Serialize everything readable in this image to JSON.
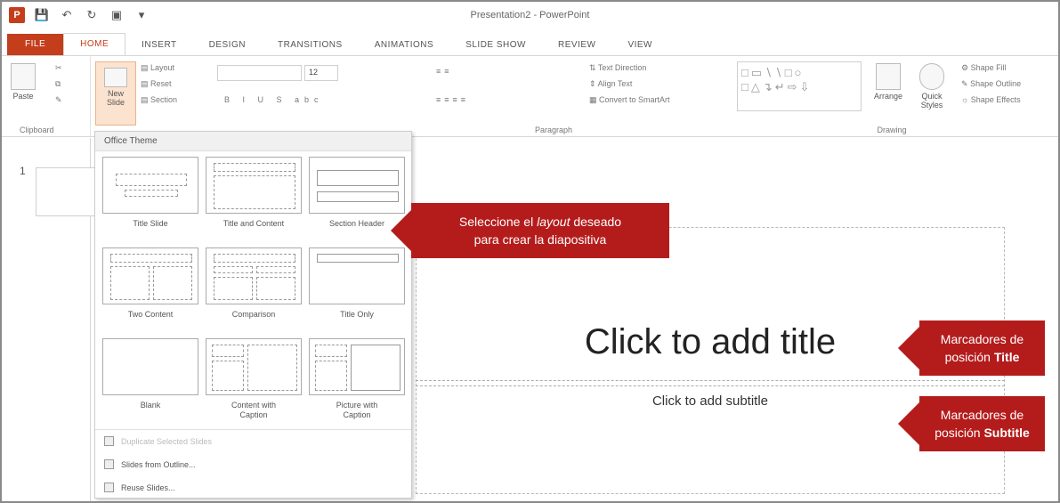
{
  "window": {
    "title": "Presentation2 - PowerPoint"
  },
  "tabs": [
    {
      "label": "FILE"
    },
    {
      "label": "HOME"
    },
    {
      "label": "INSERT"
    },
    {
      "label": "DESIGN"
    },
    {
      "label": "TRANSITIONS"
    },
    {
      "label": "ANIMATIONS"
    },
    {
      "label": "SLIDE SHOW"
    },
    {
      "label": "REVIEW"
    },
    {
      "label": "VIEW"
    }
  ],
  "ribbon": {
    "clipboard": {
      "paste": "Paste",
      "label": "Clipboard"
    },
    "slides": {
      "new_slide": "New Slide",
      "layout": "Layout",
      "reset": "Reset",
      "section": "Section"
    },
    "font": {
      "size": "12"
    },
    "paragraph": {
      "label": "Paragraph",
      "text_direction": "Text Direction",
      "align_text": "Align Text",
      "smartart": "Convert to SmartArt"
    },
    "drawing": {
      "label": "Drawing",
      "arrange": "Arrange",
      "quick_styles": "Quick Styles",
      "shape_fill": "Shape Fill",
      "shape_outline": "Shape Outline",
      "shape_effects": "Shape Effects"
    }
  },
  "thumbnail": {
    "number": "1"
  },
  "gallery": {
    "header": "Office Theme",
    "layouts": [
      {
        "name": "Title Slide"
      },
      {
        "name": "Title and Content"
      },
      {
        "name": "Section Header"
      },
      {
        "name": "Two Content"
      },
      {
        "name": "Comparison"
      },
      {
        "name": "Title Only"
      },
      {
        "name": "Blank"
      },
      {
        "name": "Content with\nCaption"
      },
      {
        "name": "Picture with\nCaption"
      }
    ],
    "menu": {
      "duplicate": "Duplicate Selected Slides",
      "outline": "Slides from Outline...",
      "reuse": "Reuse Slides..."
    }
  },
  "slide": {
    "title_placeholder": "Click to add title",
    "subtitle_placeholder": "Click to add subtitle"
  },
  "callouts": {
    "layout_pre": "Seleccione el ",
    "layout_em": "layout",
    "layout_post": " deseado",
    "layout_line2": "para crear la diapositiva",
    "title_line1": "Marcadores de",
    "title_pre": "posición ",
    "title_em": "Title",
    "subtitle_line1": "Marcadores de",
    "subtitle_pre": "posición ",
    "subtitle_em": "Subtitle"
  },
  "colors": {
    "accent": "#c43e1c",
    "callout": "#b41c1c"
  }
}
